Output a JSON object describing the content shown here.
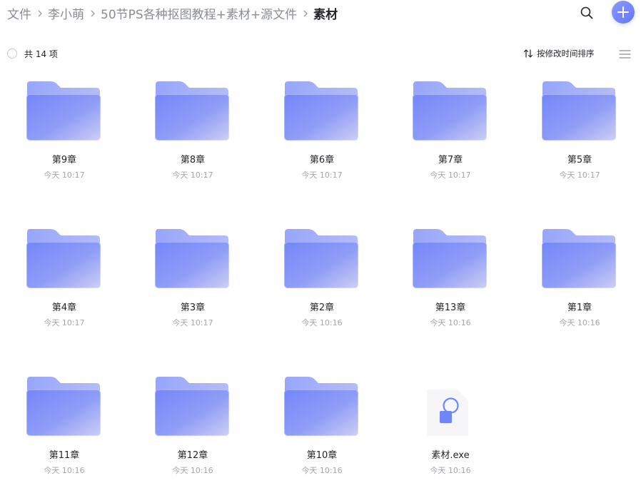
{
  "breadcrumb": [
    {
      "label": "文件"
    },
    {
      "label": "李小萌"
    },
    {
      "label": "50节PS各种抠图教程+素材+源文件"
    },
    {
      "label": "素材"
    }
  ],
  "toolbar": {
    "count_label": "共 14 项",
    "sort_label": "按修改时间排序"
  },
  "icons": {
    "search": "search-icon",
    "add": "plus-icon",
    "sort": "sort-arrows-icon",
    "view": "list-view-icon",
    "folder": "folder-icon",
    "exe": "exe-file-icon"
  },
  "colors": {
    "accent": "#6f7ffb",
    "folder_back": "#9aa9fb",
    "folder_front_start": "#7b8cf9",
    "folder_front_end": "#c8ccf4",
    "text_primary": "#25262b",
    "text_secondary": "#a4a6ad"
  },
  "files": [
    {
      "name": "第9章",
      "time": "今天 10:17",
      "type": "folder"
    },
    {
      "name": "第8章",
      "time": "今天 10:17",
      "type": "folder"
    },
    {
      "name": "第6章",
      "time": "今天 10:17",
      "type": "folder"
    },
    {
      "name": "第7章",
      "time": "今天 10:17",
      "type": "folder"
    },
    {
      "name": "第5章",
      "time": "今天 10:17",
      "type": "folder"
    },
    {
      "name": "第4章",
      "time": "今天 10:17",
      "type": "folder"
    },
    {
      "name": "第3章",
      "time": "今天 10:17",
      "type": "folder"
    },
    {
      "name": "第2章",
      "time": "今天 10:16",
      "type": "folder"
    },
    {
      "name": "第13章",
      "time": "今天 10:16",
      "type": "folder"
    },
    {
      "name": "第1章",
      "time": "今天 10:16",
      "type": "folder"
    },
    {
      "name": "第11章",
      "time": "今天 10:16",
      "type": "folder"
    },
    {
      "name": "第12章",
      "time": "今天 10:16",
      "type": "folder"
    },
    {
      "name": "第10章",
      "time": "今天 10:16",
      "type": "folder"
    },
    {
      "name": "素材.exe",
      "time": "今天 10:16",
      "type": "exe"
    }
  ]
}
